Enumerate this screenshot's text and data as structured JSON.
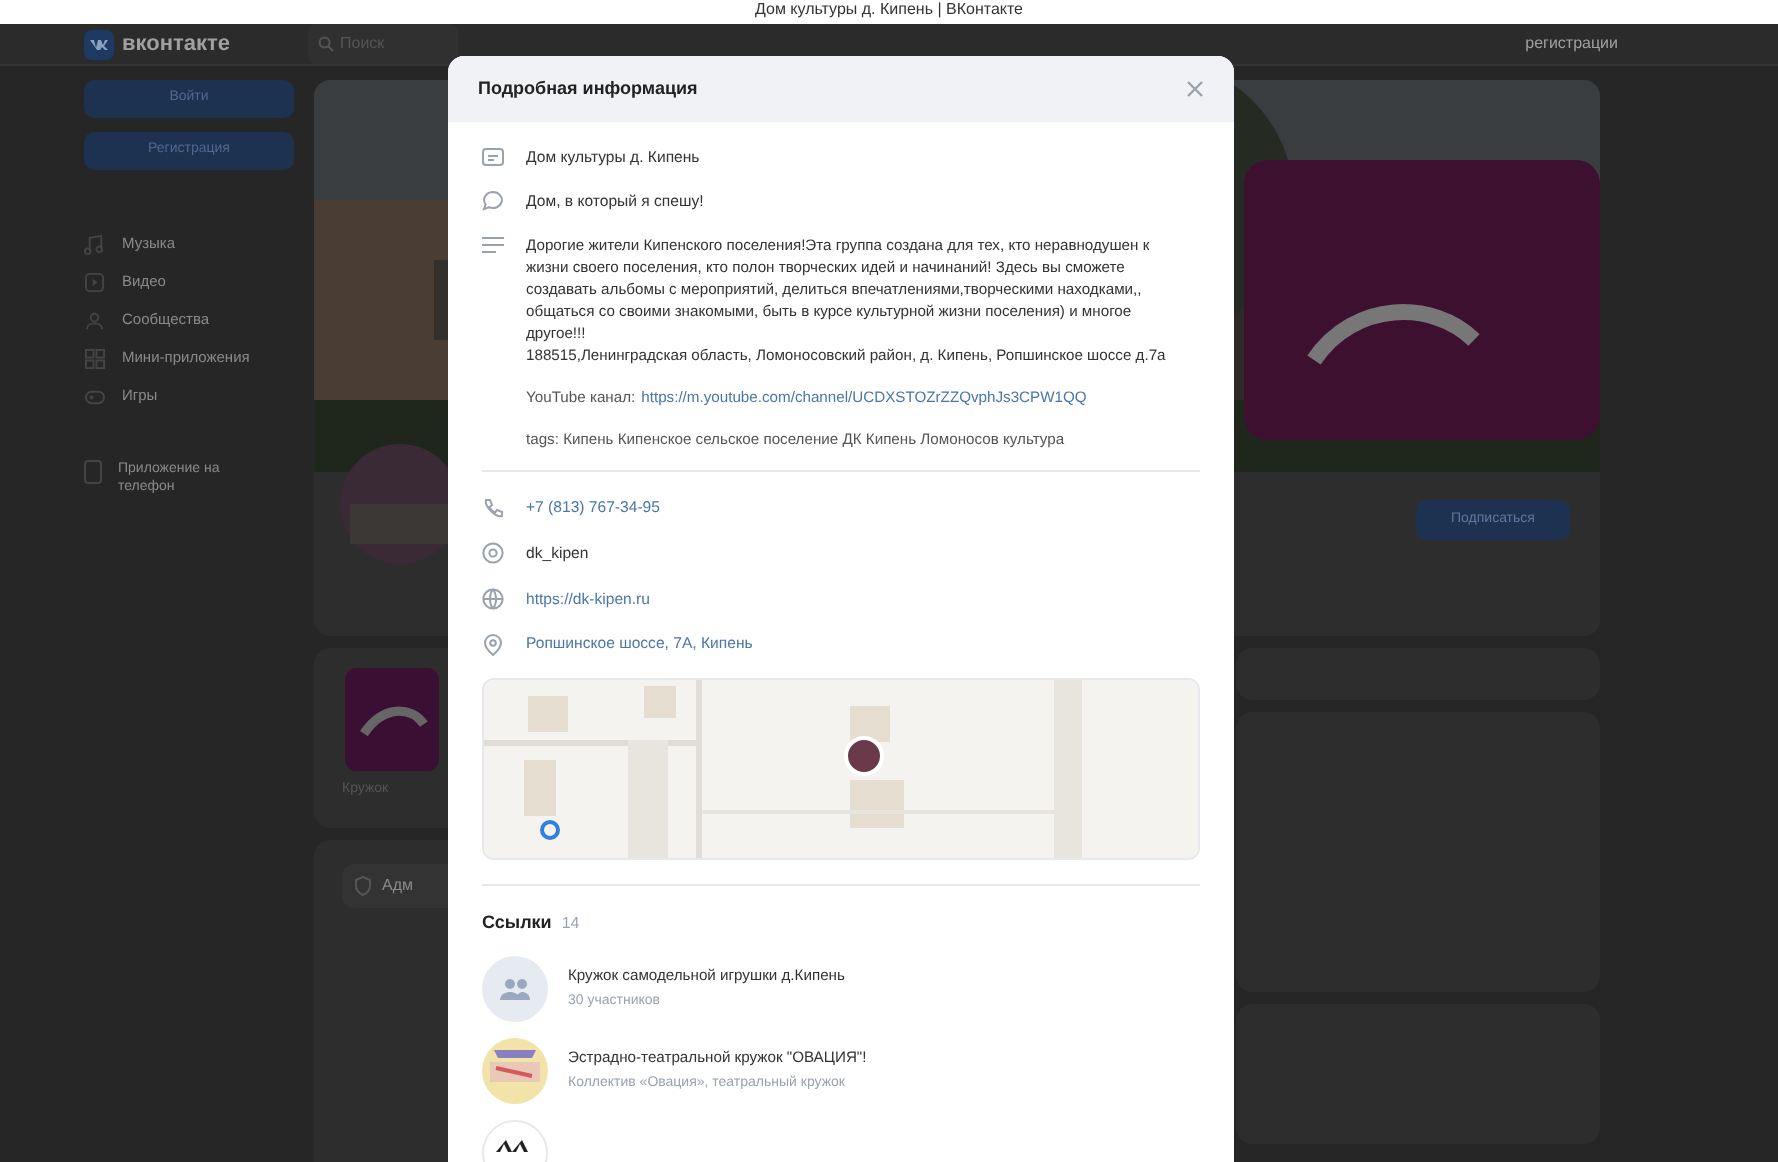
{
  "browser_title": "Дом культуры д. Кипень | ВКонтакте",
  "header": {
    "logo": "вконтакте",
    "search_placeholder": "Поиск",
    "register_link": "регистрации"
  },
  "sidebar": {
    "buttons": [
      "Войти",
      "Регистрация"
    ],
    "items": [
      {
        "label": "Музыка"
      },
      {
        "label": "Видео"
      },
      {
        "label": "Сообщества"
      },
      {
        "label": "Мини-приложения"
      },
      {
        "label": "Игры"
      }
    ],
    "app_link": "Приложение на телефон"
  },
  "group": {
    "subscribe_button": "Подписаться",
    "card_captions": [
      "Кружок",
      "Адм"
    ]
  },
  "modal": {
    "title": "Подробная информация",
    "rows": [
      {
        "kind": "name",
        "text": "Дом культуры д. Кипень"
      },
      {
        "kind": "status",
        "text": "Дом, в который я спешу!"
      }
    ],
    "description": [
      "Дорогие жители Кипенского поселения!Эта группа создана для тех, кто неравнодушен к жизни своего поселения, кто полон творческих идей и начинаний! Здесь вы сможете создавать альбомы с мероприятий, делиться впечатлениями,творческими находками,, общаться со своими знакомыми, быть в курсе культурной жизни поселения) и многое другое!!!",
      "188515,Ленинградская область, Ломоносовский район, д. Кипень, Ропшинское шоссе д.7а"
    ],
    "youtube": {
      "label": "YouTube канал:",
      "url": "https://m.youtube.com/channel/UCDXSTOZrZZQvphJs3CPW1QQ"
    },
    "tags": "tags: Кипень Кипенское сельское поселение ДК Кипень Ломоносов культура",
    "contacts": [
      {
        "kind": "phone",
        "text": "+7 (813) 767-34-95",
        "link": true
      },
      {
        "kind": "handle",
        "text": "dk_kipen",
        "link": false
      },
      {
        "kind": "website",
        "text": "https://dk-kipen.ru",
        "link": true
      },
      {
        "kind": "address",
        "text": "Ропшинское шоссе, 7А, Кипень",
        "link": true
      }
    ],
    "map": {
      "kind": "picture"
    },
    "links": {
      "title": "Ссылки",
      "count": "14",
      "items": [
        {
          "kind": "group",
          "title": "Кружок самодельной игрушки д.Кипень",
          "subtitle": "30 участников"
        },
        {
          "title": "Эстрадно-театральной кружок \"ОВАЦИЯ\"!",
          "subtitle": "Коллектив «Овация», театральный кружок"
        },
        {
          "kind": "dark"
        }
      ]
    }
  }
}
